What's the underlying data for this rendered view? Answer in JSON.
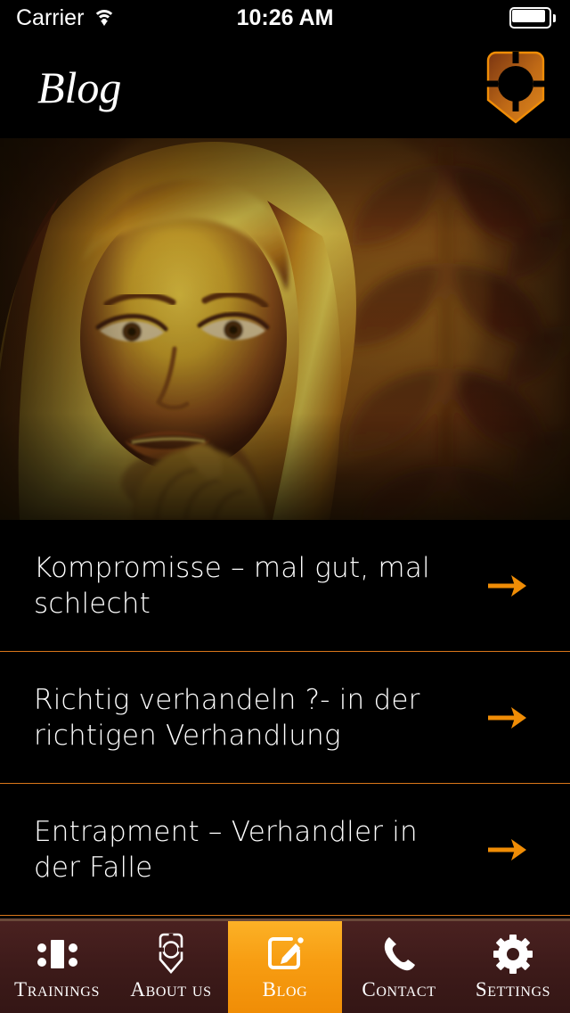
{
  "status_bar": {
    "carrier": "Carrier",
    "wifi_icon": "wifi-icon",
    "time": "10:26 AM",
    "battery_icon": "battery-full-icon"
  },
  "nav_bar": {
    "title": "Blog",
    "logo_icon": "shield-crosshair-logo-icon"
  },
  "hero": {
    "alt": "Sepia toned portrait of a blonde woman resting her chin on her hand in front of a leaf patterned wall",
    "accent": "#c98b1e"
  },
  "posts": {
    "arrow_icon": "arrow-right-icon",
    "items": [
      {
        "title": "Kompromisse – mal gut, mal schlecht"
      },
      {
        "title": "Richtig verhandeln ?- in der richtigen Verhandlung"
      },
      {
        "title": "Entrapment – Verhandler in der Falle"
      }
    ]
  },
  "tab_bar": {
    "active_index": 2,
    "items": [
      {
        "label": "Trainings",
        "icon": "meeting-table-icon"
      },
      {
        "label": "About Us",
        "icon": "shield-crosshair-icon"
      },
      {
        "label": "Blog",
        "icon": "compose-pencil-icon"
      },
      {
        "label": "Contact",
        "icon": "phone-icon"
      },
      {
        "label": "Settings",
        "icon": "gear-icon"
      }
    ]
  },
  "colors": {
    "accent_orange": "#f79d12",
    "separator_orange": "#d9761a",
    "tabbar_maroon": "#3c1a19",
    "background_black": "#000000"
  }
}
